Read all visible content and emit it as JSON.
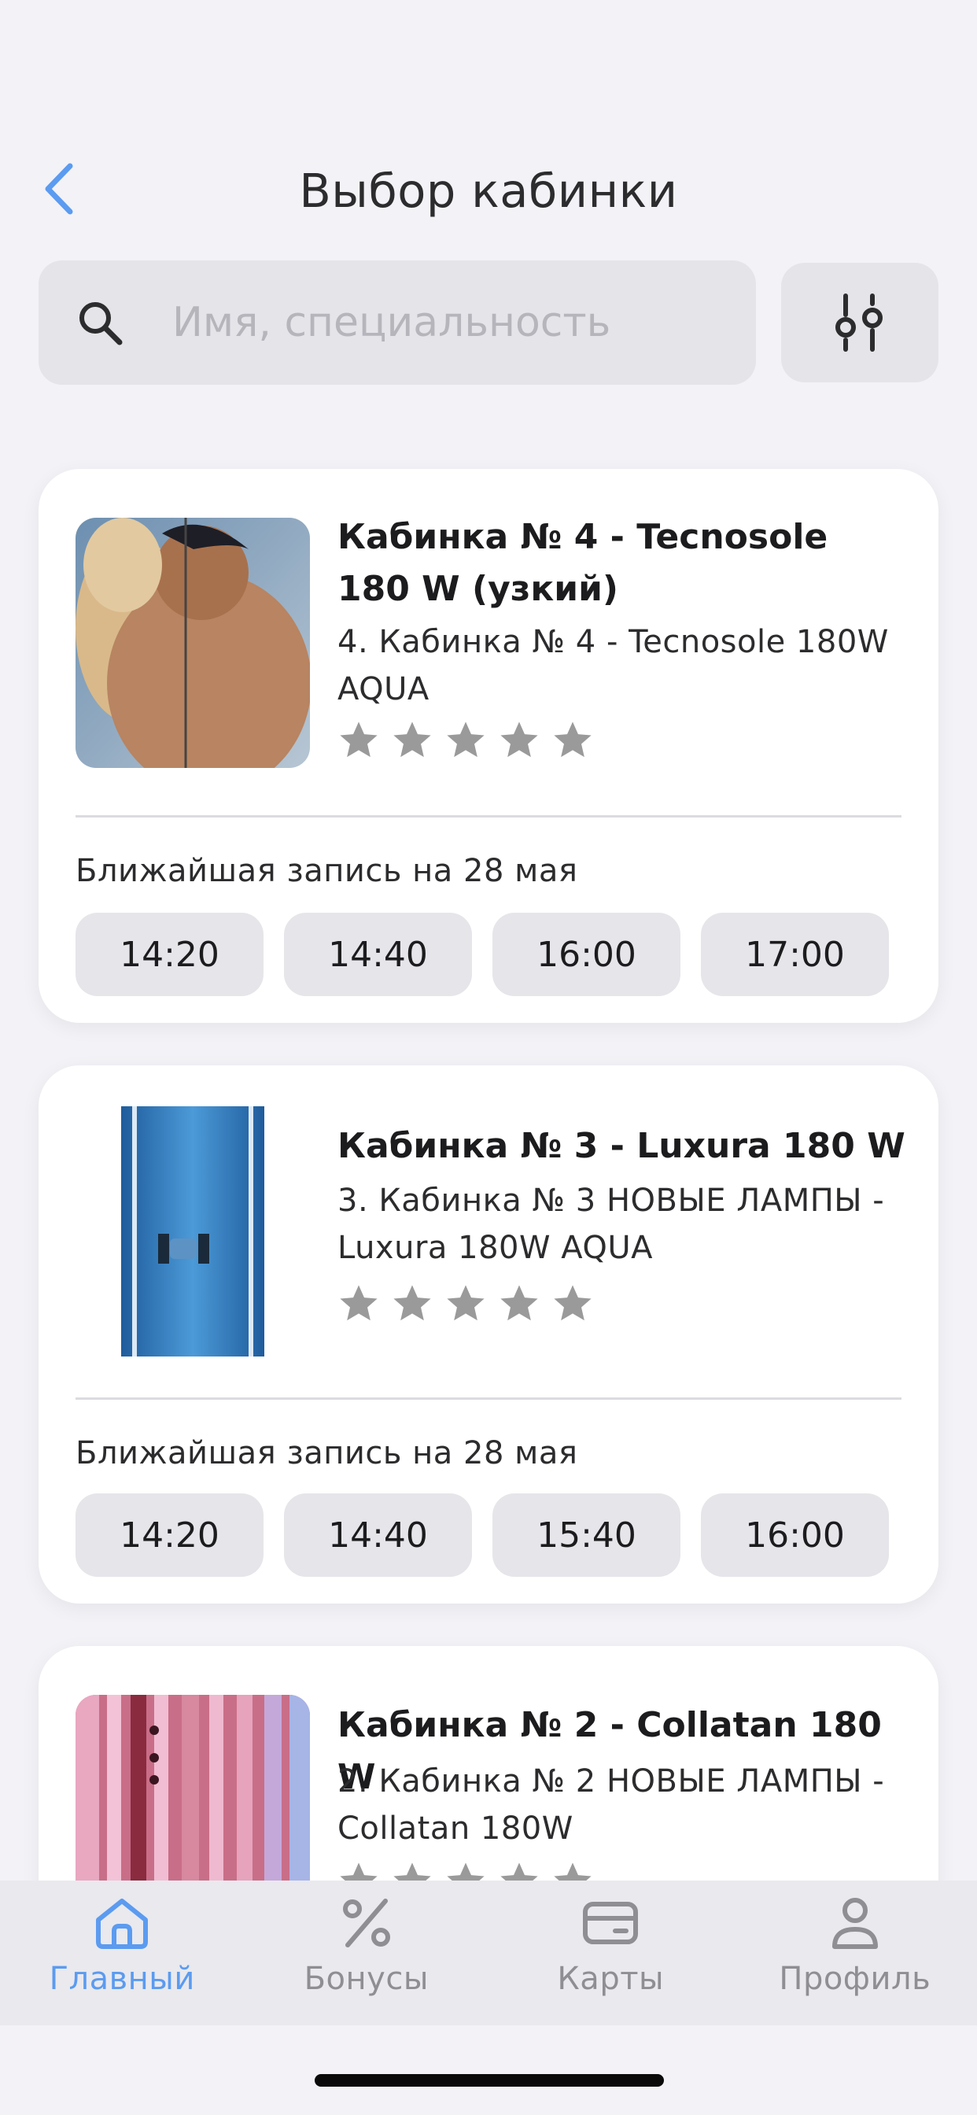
{
  "header": {
    "title": "Выбор кабинки"
  },
  "search": {
    "placeholder": "Имя, специальность"
  },
  "cards": [
    {
      "name": "Кабинка № 4 - Tecnosole 180 W (узкий)",
      "description": "4. Кабинка № 4 - Tecnosole 180W AQUA",
      "rating": 0,
      "nearest": "Ближайшая запись на 28 мая",
      "slots": [
        "14:20",
        "14:40",
        "16:00",
        "17:00"
      ]
    },
    {
      "name": "Кабинка № 3 -  Luxura 180 W",
      "description": "3. Кабинка № 3 НОВЫЕ ЛАМПЫ - Luxura 180W AQUA",
      "rating": 0,
      "nearest": "Ближайшая запись на 28 мая",
      "slots": [
        "14:20",
        "14:40",
        "15:40",
        "16:00"
      ]
    },
    {
      "name": "Кабинка № 2 - Collatan 180 W",
      "description": "2. Кабинка № 2 НОВЫЕ ЛАМПЫ -  Collatan 180W",
      "rating": 0
    }
  ],
  "tabbar": {
    "items": [
      {
        "label": "Главный",
        "icon": "home-icon",
        "active": true
      },
      {
        "label": "Бонусы",
        "icon": "percent-icon",
        "active": false
      },
      {
        "label": "Карты",
        "icon": "card-icon",
        "active": false
      },
      {
        "label": "Профиль",
        "icon": "profile-icon",
        "active": false
      }
    ]
  },
  "colors": {
    "accent": "#5b9bf0",
    "star": "#9a9a9a",
    "background": "#f2f2f7"
  }
}
